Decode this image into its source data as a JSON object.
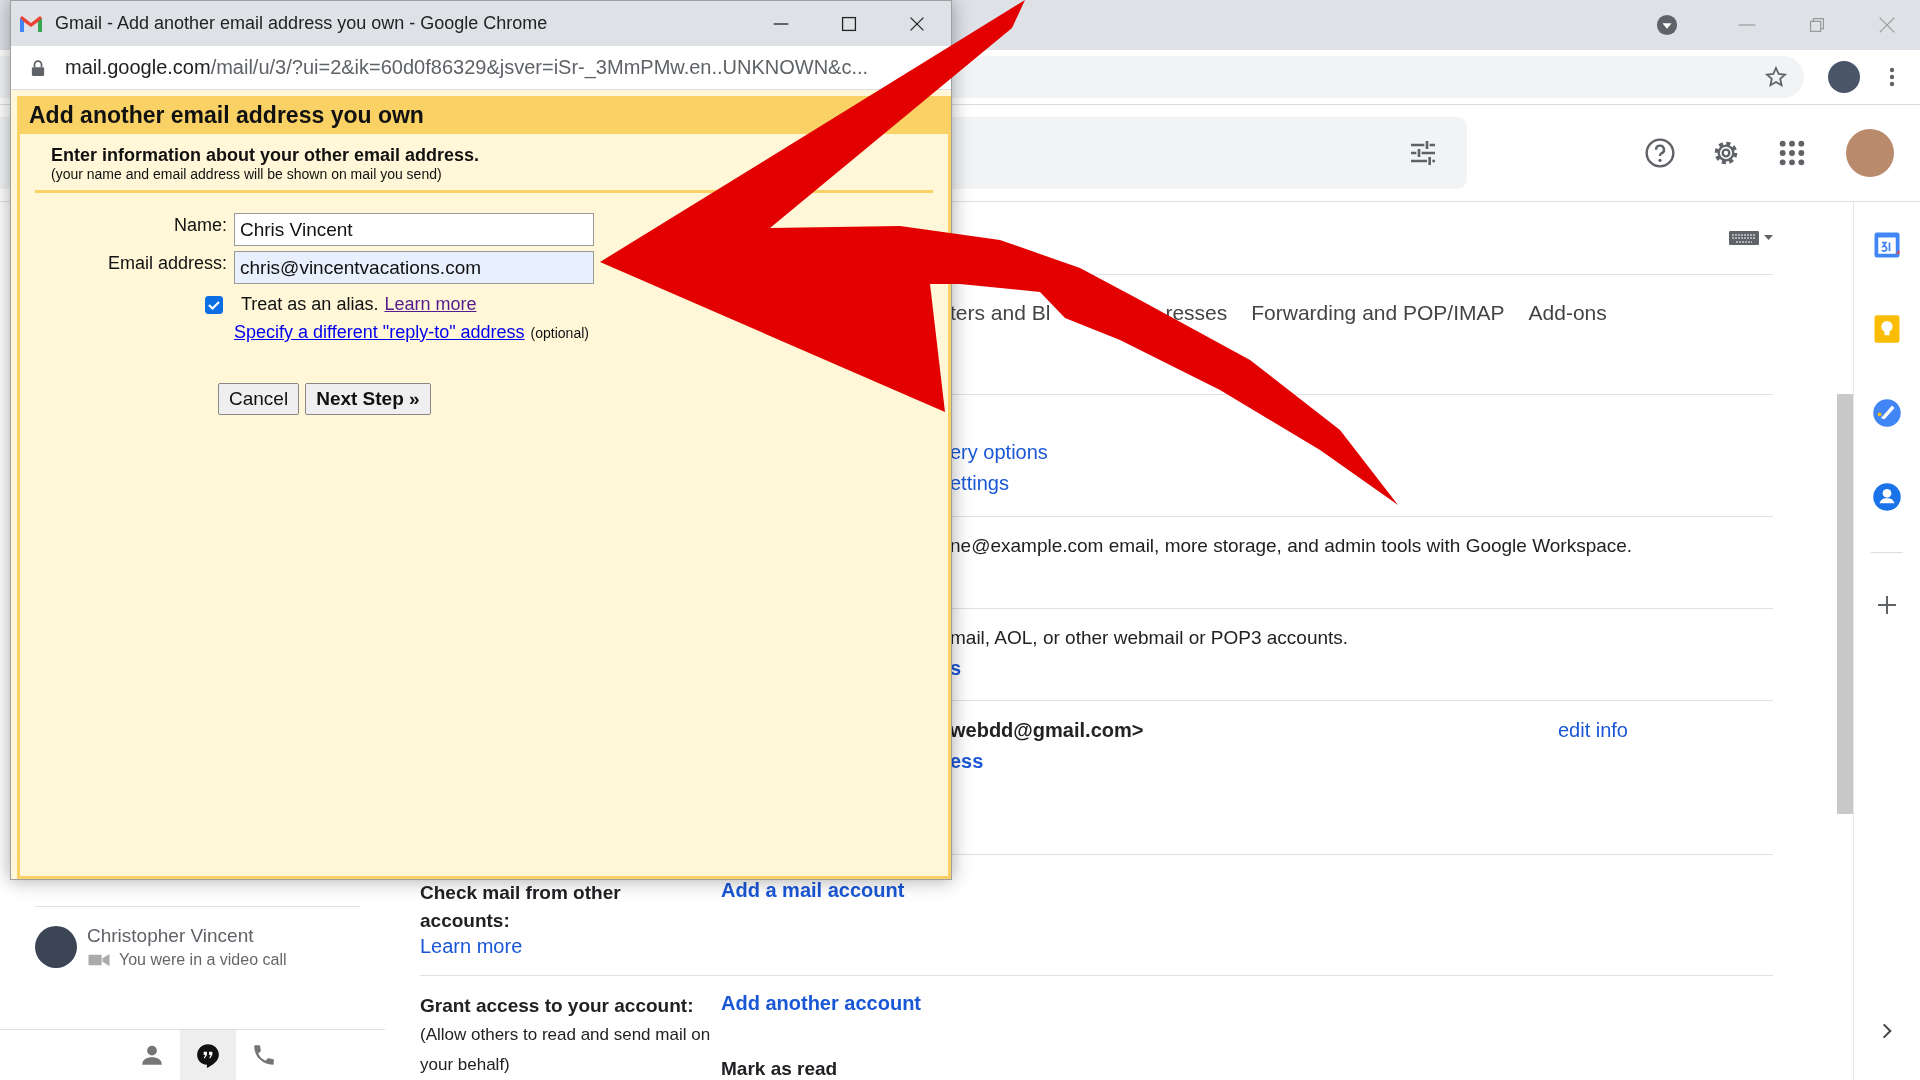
{
  "popup": {
    "title": "Gmail - Add another email address you own - Google Chrome",
    "url_host": "mail.google.com",
    "url_rest": "/mail/u/3/?ui=2&ik=60d0f86329&jsver=iSr-_3MmPMw.en..UNKNOWN&c...",
    "heading": "Add another email address you own",
    "intro": "Enter information about your other email address.",
    "note": "(your name and email address will be shown on mail you send)",
    "fields": [
      {
        "label": "Name:",
        "value": "Chris Vincent",
        "autofilled": false
      },
      {
        "label": "Email address:",
        "value": "chris@vincentvacations.com",
        "autofilled": true
      }
    ],
    "alias": {
      "label": "Treat as an alias.",
      "checked": true,
      "link": "Learn more"
    },
    "reply_to": {
      "link": "Specify a different \"reply-to\" address",
      "note": "(optional)"
    },
    "buttons": [
      {
        "label": "Cancel",
        "primary": false
      },
      {
        "label": "Next Step »",
        "primary": true
      }
    ]
  },
  "settings": {
    "tabs": [
      {
        "label": "ters and Bl",
        "selected": false
      },
      {
        "label": "resses",
        "selected": false
      },
      {
        "label": "Forwarding and POP/IMAP",
        "selected": false
      },
      {
        "label": "Add-ons",
        "selected": false
      }
    ],
    "partial_sections": [
      {
        "lines": [
          {
            "kind": "link",
            "text": "ery options"
          },
          {
            "kind": "link",
            "text": "ettings"
          }
        ]
      },
      {
        "lines": [
          {
            "kind": "text",
            "text": "ne@example.com email, more storage, and admin tools with Google Workspace."
          }
        ]
      },
      {
        "lines": [
          {
            "kind": "text",
            "text": "mail, AOL, or other webmail or POP3 accounts."
          },
          {
            "kind": "strong_link",
            "text": "s"
          }
        ]
      },
      {
        "lines": [
          {
            "kind": "bold",
            "text": "webdd@gmail.com>"
          },
          {
            "kind": "strong_link",
            "text": "ess"
          }
        ],
        "action": "edit info"
      }
    ],
    "sections": [
      {
        "label": "Check mail from other accounts:",
        "help": "Learn more",
        "action": "Add a mail account"
      },
      {
        "label": "Grant access to your account:",
        "help_note": "(Allow others to read and send mail on your behalf)",
        "action": "Add another account",
        "extra": "Mark as read"
      }
    ]
  },
  "sidebar": {
    "contact": {
      "name": "Christopher Vincent",
      "status": "You were in a video call"
    },
    "bottom_tabs": [
      {
        "kind": "person",
        "selected": false
      },
      {
        "kind": "chat",
        "selected": true
      },
      {
        "kind": "phone",
        "selected": false
      }
    ]
  }
}
